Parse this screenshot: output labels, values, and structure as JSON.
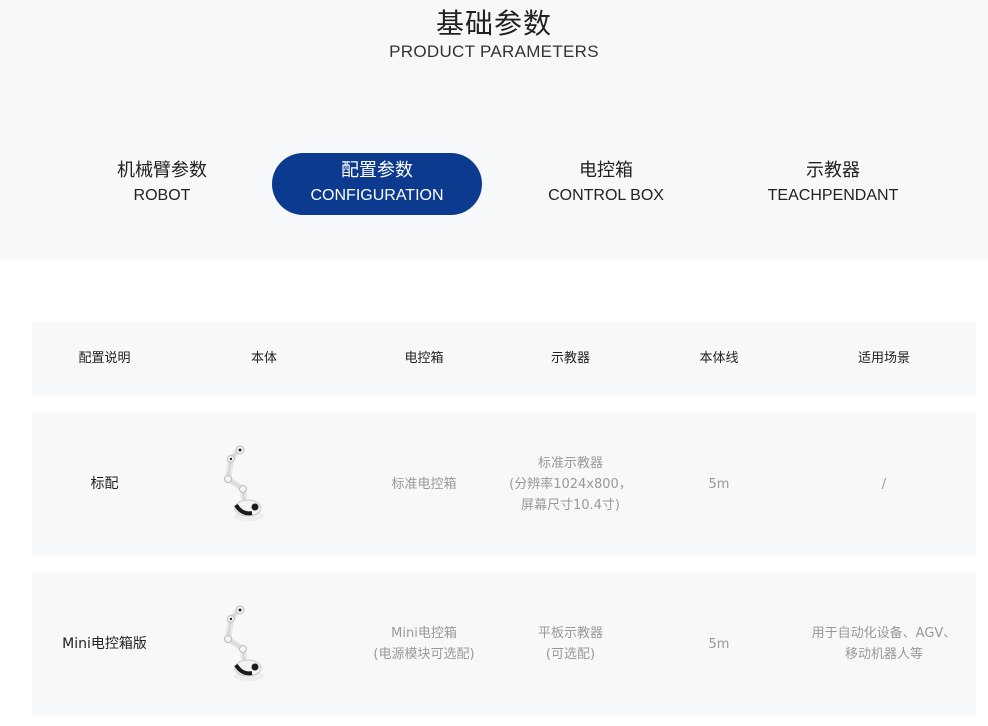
{
  "header": {
    "title_cn": "基础参数",
    "title_en": "PRODUCT PARAMETERS"
  },
  "tabs": [
    {
      "cn": "机械臂参数",
      "en": "ROBOT",
      "active": false
    },
    {
      "cn": "配置参数",
      "en": "CONFIGURATION",
      "active": true
    },
    {
      "cn": "电控箱",
      "en": "CONTROL BOX",
      "active": false
    },
    {
      "cn": "示教器",
      "en": "TEACHPENDANT",
      "active": false
    }
  ],
  "table": {
    "headers": [
      "配置说明",
      "本体",
      "电控箱",
      "示教器",
      "本体线",
      "适用场景"
    ],
    "rows": [
      {
        "config": "标配",
        "body_image": "robot-arm-image",
        "control_box": [
          "标准电控箱"
        ],
        "teach_pendant": [
          "标准示教器",
          "(分辨率1024x800，",
          "屏幕尺寸10.4寸)"
        ],
        "cable": "5m",
        "scenario": [
          "/"
        ]
      },
      {
        "config": "Mini电控箱版",
        "body_image": "robot-arm-image",
        "control_box": [
          "Mini电控箱",
          "(电源模块可选配)"
        ],
        "teach_pendant": [
          "平板示教器",
          "(可选配)"
        ],
        "cable": "5m",
        "scenario": [
          "用于自动化设备、AGV、",
          "移动机器人等"
        ]
      }
    ]
  },
  "colors": {
    "accent": "#0b3a8e",
    "band_bg": "#f6f8fa",
    "muted_text": "#999999"
  }
}
